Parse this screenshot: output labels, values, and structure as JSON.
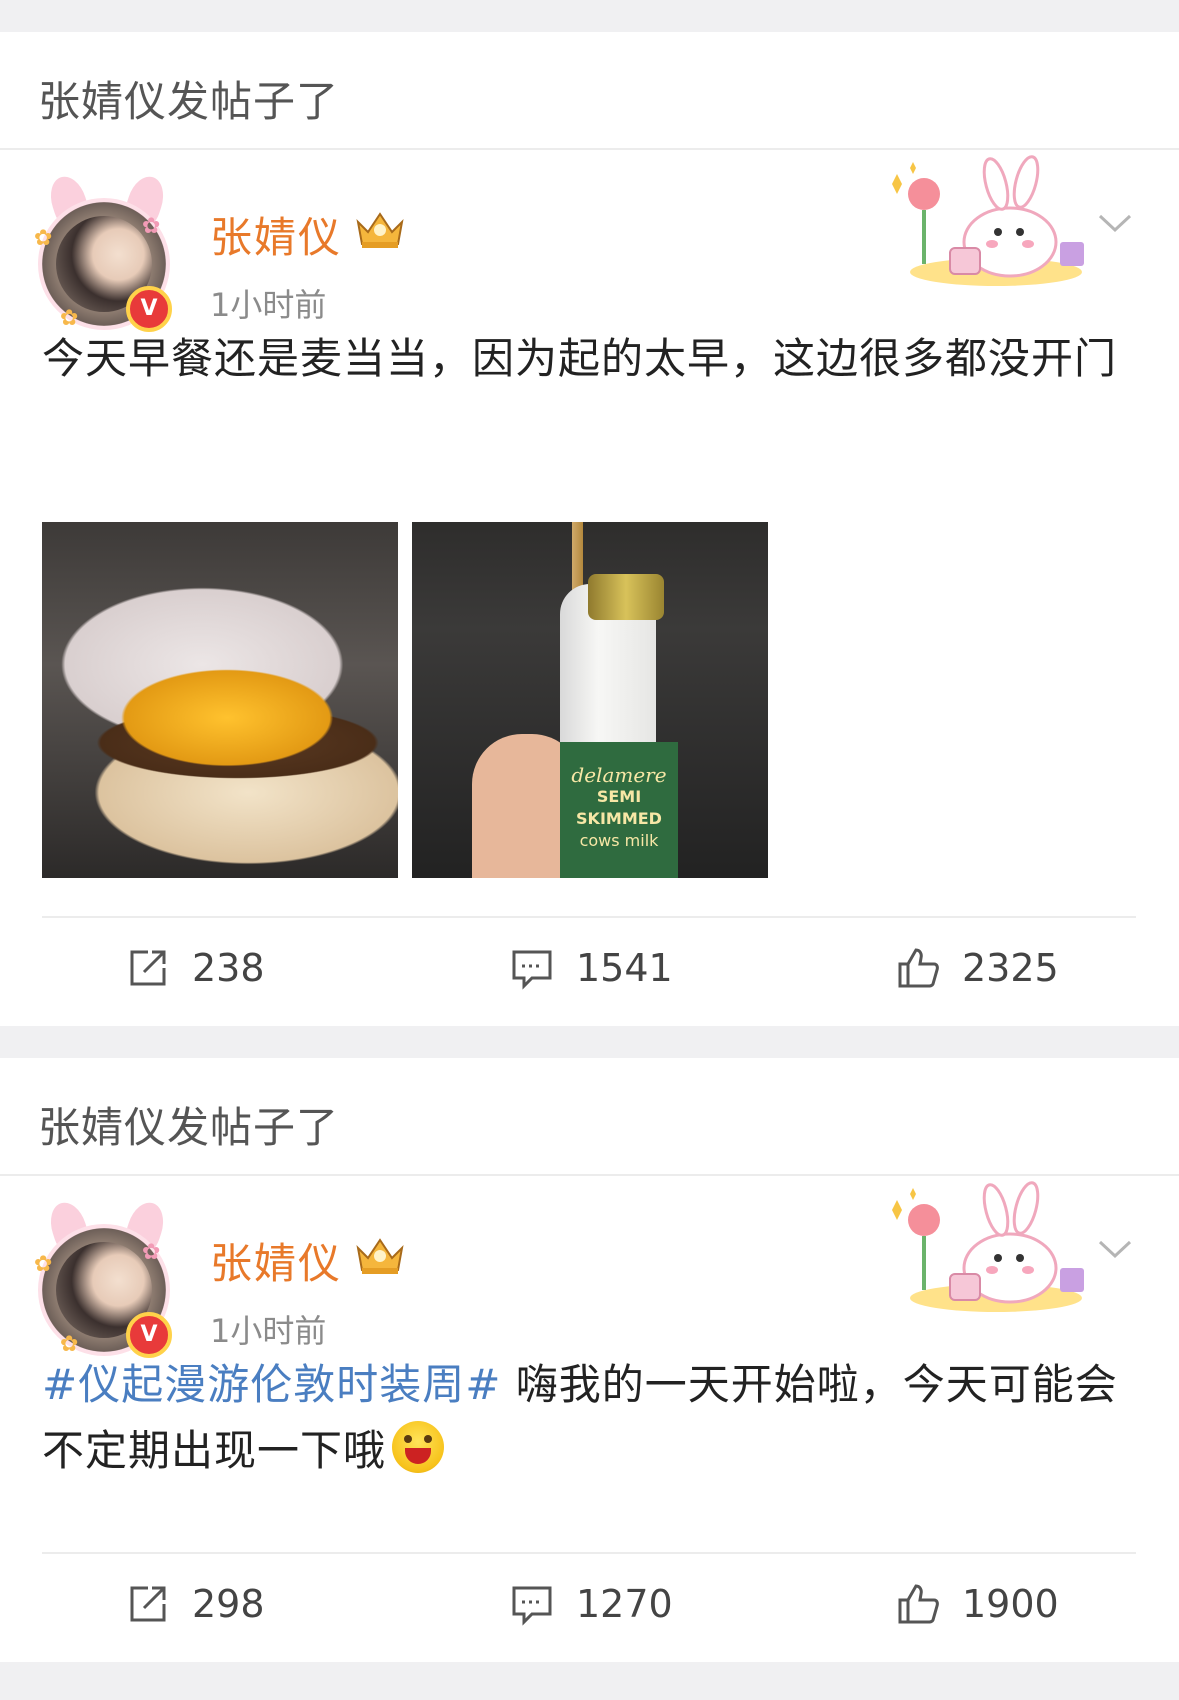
{
  "posts": [
    {
      "section_title": "张婧仪发帖子了",
      "author": "张婧仪",
      "time": "1小时前",
      "text": "今天早餐还是麦当当，因为起的太早，这边很多都没开门",
      "images": [
        "burger-photo",
        "milk-bottle-photo"
      ],
      "bottle_label": {
        "brand": "delamere",
        "line1": "SEMI SKIMMED",
        "line2": "cows milk"
      },
      "actions": {
        "repost": "238",
        "comment": "1541",
        "like": "2325"
      }
    },
    {
      "section_title": "张婧仪发帖子了",
      "author": "张婧仪",
      "time": "1小时前",
      "hashtag": "#仪起漫游伦敦时装周#",
      "text": " 嗨我的一天开始啦，今天可能会不定期出现一下哦",
      "emoji": "laughing-face-icon",
      "actions": {
        "repost": "298",
        "comment": "1270",
        "like": "1900"
      }
    }
  ],
  "icons": [
    "repost-icon",
    "comment-icon",
    "like-icon",
    "chevron-down-icon",
    "verified-v-icon",
    "crown-icon"
  ],
  "colors": {
    "username": "#e8792a",
    "hashtag": "#4a7ec1",
    "verified": "#e83a3a"
  }
}
